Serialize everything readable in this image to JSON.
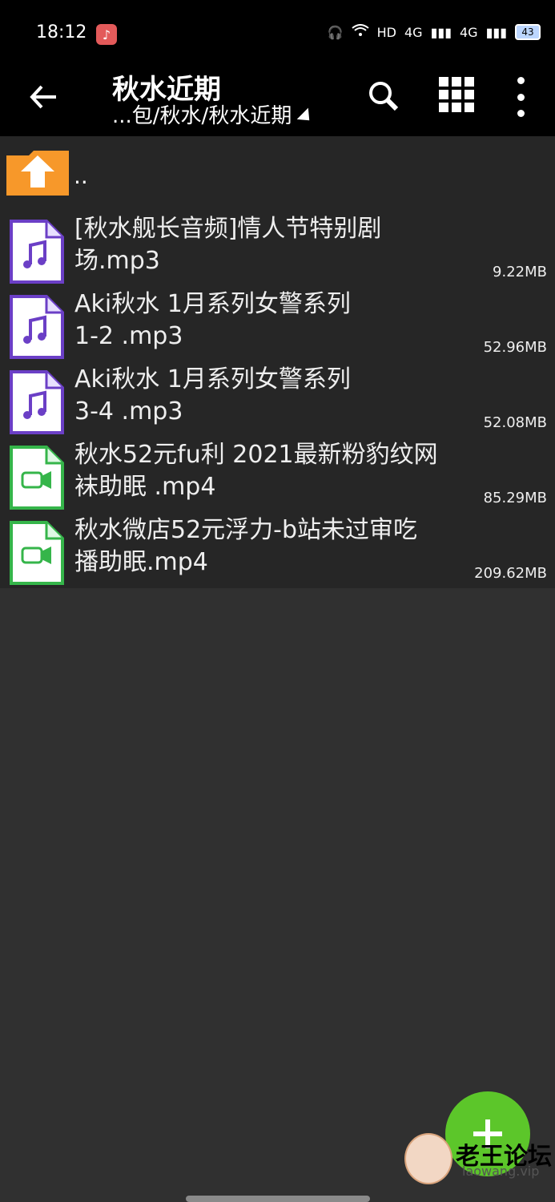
{
  "status_bar": {
    "time": "18:12",
    "network": "HD",
    "signal_1": "4G",
    "signal_2": "4G",
    "battery": "43"
  },
  "header": {
    "title": "秋水近期",
    "path": "...包/秋水/秋水近期"
  },
  "list": {
    "parent_label": "..",
    "files": [
      {
        "name_line1": "[秋水舰长音频]情人节特别剧",
        "name_line2": "场.mp3",
        "size": "9.22MB",
        "type": "audio"
      },
      {
        "name_line1": "Aki秋水 1月系列女警系列",
        "name_line2": "1-2 .mp3",
        "size": "52.96MB",
        "type": "audio"
      },
      {
        "name_line1": "Aki秋水 1月系列女警系列",
        "name_line2": "3-4 .mp3",
        "size": "52.08MB",
        "type": "audio"
      },
      {
        "name_line1": "秋水52元fu利 2021最新粉豹纹网",
        "name_line2": "袜助眠 .mp4",
        "size": "85.29MB",
        "type": "video"
      },
      {
        "name_line1": "秋水微店52元浮力-b站未过审吃",
        "name_line2": "播助眠.mp4",
        "size": "209.62MB",
        "type": "video"
      }
    ]
  },
  "watermark": {
    "text": "老王论坛",
    "url": "laowang.vip"
  },
  "colors": {
    "background": "#303030",
    "list_background": "#262626",
    "header": "#000000",
    "fab": "#5cc62a",
    "audio_icon": "#6b3fc6",
    "video_icon": "#35b54a",
    "folder_icon": "#f7982a"
  }
}
